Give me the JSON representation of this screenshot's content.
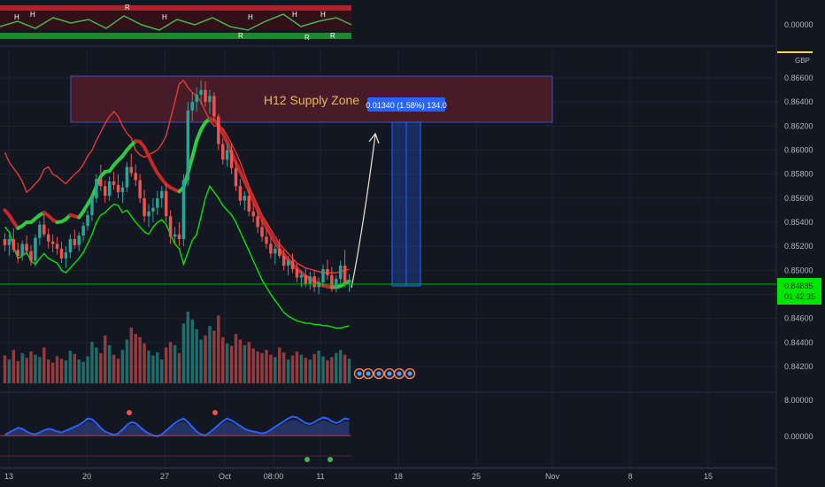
{
  "currency": "GBP",
  "price_axis": {
    "main_ticks": [
      "0.86600",
      "0.86400",
      "0.86200",
      "0.86000",
      "0.85800",
      "0.85600",
      "0.85400",
      "0.85200",
      "0.85000",
      "0.84800",
      "0.84600",
      "0.84400",
      "0.84200"
    ],
    "top_ticks": [
      "0.00000"
    ],
    "bottom_ticks": [
      "8.00000",
      "0.00000"
    ],
    "last_price": "0.84885",
    "countdown": "01:42:35"
  },
  "time_axis": {
    "labels": [
      "13",
      "20",
      "27",
      "Oct",
      "08:00",
      "11",
      "18",
      "25",
      "Nov",
      "8",
      "15"
    ]
  },
  "annotations": {
    "supply_zone_label": "H12 Supply Zone",
    "measure_label": "0.01340 (1.58%) 134.0"
  },
  "colors": {
    "background": "#131722",
    "up": "#26a69a",
    "down": "#ef5350",
    "supply_zone": "#5a1e2a",
    "measure": "#2962ff",
    "last_price": "#00e600"
  },
  "chart_data": {
    "type": "candlestick",
    "title": "",
    "ylim": [
      0.8408,
      0.8668
    ],
    "x_ticks": [
      "13",
      "20",
      "27",
      "Oct",
      "08:00",
      "11",
      "18",
      "25",
      "Nov",
      "8",
      "15"
    ],
    "candles": [
      [
        0.8526,
        0.8531,
        0.8516,
        0.8521
      ],
      [
        0.8521,
        0.853,
        0.8512,
        0.8526
      ],
      [
        0.8526,
        0.8535,
        0.8515,
        0.8517
      ],
      [
        0.8517,
        0.8523,
        0.8506,
        0.8512
      ],
      [
        0.8512,
        0.8525,
        0.8508,
        0.8522
      ],
      [
        0.8522,
        0.8529,
        0.8513,
        0.8516
      ],
      [
        0.8516,
        0.8521,
        0.8504,
        0.8508
      ],
      [
        0.8508,
        0.853,
        0.8503,
        0.8527
      ],
      [
        0.8527,
        0.8541,
        0.8521,
        0.8538
      ],
      [
        0.8538,
        0.8547,
        0.8528,
        0.853
      ],
      [
        0.853,
        0.8535,
        0.8518,
        0.8524
      ],
      [
        0.8524,
        0.853,
        0.8515,
        0.8522
      ],
      [
        0.8522,
        0.8528,
        0.8513,
        0.8518
      ],
      [
        0.8518,
        0.8524,
        0.8506,
        0.851
      ],
      [
        0.851,
        0.852,
        0.8502,
        0.8515
      ],
      [
        0.8515,
        0.853,
        0.851,
        0.8526
      ],
      [
        0.8526,
        0.8534,
        0.8518,
        0.8521
      ],
      [
        0.8521,
        0.8532,
        0.8516,
        0.8529
      ],
      [
        0.8529,
        0.854,
        0.8524,
        0.8537
      ],
      [
        0.8537,
        0.855,
        0.8533,
        0.8546
      ],
      [
        0.8546,
        0.8565,
        0.8541,
        0.856
      ],
      [
        0.856,
        0.858,
        0.8556,
        0.8576
      ],
      [
        0.8576,
        0.8588,
        0.8566,
        0.857
      ],
      [
        0.857,
        0.8575,
        0.8556,
        0.8562
      ],
      [
        0.8562,
        0.8578,
        0.8558,
        0.8574
      ],
      [
        0.8574,
        0.8582,
        0.8567,
        0.8571
      ],
      [
        0.8571,
        0.858,
        0.856,
        0.8565
      ],
      [
        0.8565,
        0.8574,
        0.8556,
        0.8569
      ],
      [
        0.8569,
        0.859,
        0.8565,
        0.8586
      ],
      [
        0.8586,
        0.8597,
        0.8578,
        0.8581
      ],
      [
        0.8581,
        0.8588,
        0.857,
        0.8575
      ],
      [
        0.8575,
        0.858,
        0.8556,
        0.856
      ],
      [
        0.856,
        0.8567,
        0.854,
        0.8545
      ],
      [
        0.8545,
        0.8555,
        0.8536,
        0.8549
      ],
      [
        0.8549,
        0.856,
        0.854,
        0.8552
      ],
      [
        0.8552,
        0.8566,
        0.8546,
        0.856
      ],
      [
        0.856,
        0.857,
        0.8552,
        0.8566
      ],
      [
        0.8566,
        0.8572,
        0.854,
        0.8545
      ],
      [
        0.8545,
        0.855,
        0.8522,
        0.8528
      ],
      [
        0.8528,
        0.8536,
        0.8522,
        0.853
      ],
      [
        0.853,
        0.854,
        0.852,
        0.8526
      ],
      [
        0.8526,
        0.858,
        0.852,
        0.8575
      ],
      [
        0.8575,
        0.864,
        0.857,
        0.8633
      ],
      [
        0.8633,
        0.8648,
        0.8624,
        0.864
      ],
      [
        0.864,
        0.8652,
        0.8632,
        0.8646
      ],
      [
        0.8646,
        0.8658,
        0.8638,
        0.865
      ],
      [
        0.865,
        0.8657,
        0.8636,
        0.864
      ],
      [
        0.864,
        0.865,
        0.863,
        0.8645
      ],
      [
        0.8645,
        0.8648,
        0.8624,
        0.8628
      ],
      [
        0.8628,
        0.863,
        0.86,
        0.8605
      ],
      [
        0.8605,
        0.861,
        0.8588,
        0.8592
      ],
      [
        0.8592,
        0.8605,
        0.8586,
        0.86
      ],
      [
        0.86,
        0.8606,
        0.858,
        0.8585
      ],
      [
        0.8585,
        0.859,
        0.8566,
        0.857
      ],
      [
        0.857,
        0.8576,
        0.8554,
        0.8558
      ],
      [
        0.8558,
        0.8566,
        0.855,
        0.8562
      ],
      [
        0.8562,
        0.8567,
        0.8545,
        0.8549
      ],
      [
        0.8549,
        0.8556,
        0.854,
        0.8545
      ],
      [
        0.8545,
        0.855,
        0.8531,
        0.8536
      ],
      [
        0.8536,
        0.8542,
        0.8524,
        0.8528
      ],
      [
        0.8528,
        0.8535,
        0.8518,
        0.8522
      ],
      [
        0.8522,
        0.8528,
        0.851,
        0.8514
      ],
      [
        0.8514,
        0.8521,
        0.8505,
        0.8518
      ],
      [
        0.8518,
        0.8526,
        0.851,
        0.8512
      ],
      [
        0.8512,
        0.8517,
        0.85,
        0.8504
      ],
      [
        0.8504,
        0.8512,
        0.8496,
        0.8508
      ],
      [
        0.8508,
        0.8514,
        0.8498,
        0.8501
      ],
      [
        0.8501,
        0.8506,
        0.849,
        0.8494
      ],
      [
        0.8494,
        0.85,
        0.8486,
        0.8496
      ],
      [
        0.8496,
        0.8502,
        0.8486,
        0.8489
      ],
      [
        0.8489,
        0.8499,
        0.8484,
        0.8495
      ],
      [
        0.8495,
        0.85,
        0.8482,
        0.8486
      ],
      [
        0.8486,
        0.8494,
        0.848,
        0.849
      ],
      [
        0.849,
        0.8505,
        0.8486,
        0.8501
      ],
      [
        0.8501,
        0.8509,
        0.8492,
        0.8496
      ],
      [
        0.8496,
        0.8503,
        0.8482,
        0.8485
      ],
      [
        0.8485,
        0.8496,
        0.8482,
        0.8493
      ],
      [
        0.8493,
        0.8508,
        0.8488,
        0.8504
      ],
      [
        0.8504,
        0.8517,
        0.8486,
        0.849
      ],
      [
        0.849,
        0.8497,
        0.8482,
        0.8492
      ]
    ],
    "volume": [
      0.35,
      0.3,
      0.42,
      0.28,
      0.38,
      0.32,
      0.4,
      0.36,
      0.33,
      0.45,
      0.3,
      0.26,
      0.34,
      0.31,
      0.29,
      0.41,
      0.37,
      0.3,
      0.27,
      0.34,
      0.52,
      0.45,
      0.38,
      0.6,
      0.48,
      0.36,
      0.31,
      0.42,
      0.55,
      0.7,
      0.62,
      0.58,
      0.5,
      0.41,
      0.35,
      0.39,
      0.3,
      0.45,
      0.52,
      0.48,
      0.38,
      0.75,
      0.9,
      0.8,
      0.68,
      0.55,
      0.6,
      0.72,
      0.66,
      0.85,
      0.58,
      0.5,
      0.47,
      0.62,
      0.55,
      0.48,
      0.52,
      0.44,
      0.4,
      0.38,
      0.42,
      0.36,
      0.33,
      0.45,
      0.39,
      0.3,
      0.35,
      0.4,
      0.36,
      0.32,
      0.3,
      0.37,
      0.41,
      0.34,
      0.29,
      0.33,
      0.38,
      0.42,
      0.36,
      0.31
    ],
    "upper_band": [
      0.858,
      0.857,
      0.8562,
      0.8555,
      0.856,
      0.8568,
      0.857,
      0.8574,
      0.8578,
      0.858,
      0.8576,
      0.857,
      0.8566,
      0.8568,
      0.8572,
      0.8578,
      0.8575,
      0.8572,
      0.8578,
      0.8584,
      0.859,
      0.86,
      0.8608,
      0.8612,
      0.861,
      0.8618,
      0.8625,
      0.863,
      0.8636,
      0.864,
      0.8645,
      0.8646,
      0.864,
      0.863,
      0.862,
      0.8612,
      0.8606,
      0.86,
      0.8598,
      0.8596,
      0.8595,
      0.8598,
      0.8602,
      0.8608,
      0.8616,
      0.8622,
      0.8626,
      0.8628,
      0.8628,
      0.8626,
      0.8622,
      0.8615,
      0.8606,
      0.8598,
      0.859,
      0.8582,
      0.8574,
      0.8566,
      0.8558,
      0.855,
      0.8544,
      0.8538,
      0.8532,
      0.8526,
      0.852,
      0.8516,
      0.8512,
      0.8508,
      0.8504,
      0.85,
      0.8498,
      0.8496,
      0.8494,
      0.8492,
      0.8491,
      0.849,
      0.849,
      0.8491,
      0.8493,
      0.8495
    ],
    "lower_band": [
      0.852,
      0.8522,
      0.8518,
      0.8515,
      0.8514,
      0.8512,
      0.851,
      0.8512,
      0.8514,
      0.8516,
      0.8515,
      0.8514,
      0.8514,
      0.8513,
      0.8513,
      0.8514,
      0.8515,
      0.8516,
      0.852,
      0.8526,
      0.8532,
      0.854,
      0.8548,
      0.8552,
      0.8555,
      0.8557,
      0.8558,
      0.856,
      0.8564,
      0.8568,
      0.857,
      0.8568,
      0.8565,
      0.856,
      0.8555,
      0.855,
      0.8546,
      0.8543,
      0.854,
      0.8538,
      0.8536,
      0.854,
      0.856,
      0.858,
      0.86,
      0.8612,
      0.862,
      0.8624,
      0.8622,
      0.8615,
      0.8606,
      0.8598,
      0.859,
      0.8582,
      0.8574,
      0.8566,
      0.8558,
      0.855,
      0.8542,
      0.8535,
      0.8528,
      0.8521,
      0.8515,
      0.851,
      0.8506,
      0.8502,
      0.8498,
      0.8495,
      0.8492,
      0.849,
      0.8488,
      0.8486,
      0.8484,
      0.8483,
      0.8482,
      0.8482,
      0.8482,
      0.8483,
      0.8485,
      0.8487
    ],
    "support_line": [
      0.8536,
      0.8532,
      0.852,
      0.851,
      0.8512,
      0.8515,
      0.8508,
      0.8505,
      0.851,
      0.8514,
      0.851,
      0.8508,
      0.8506,
      0.85,
      0.8498,
      0.8502,
      0.8506,
      0.851,
      0.8515,
      0.8522,
      0.853,
      0.854,
      0.8546,
      0.8548,
      0.8552,
      0.8555,
      0.8554,
      0.8548,
      0.855,
      0.8545,
      0.854,
      0.8536,
      0.8532,
      0.853,
      0.8536,
      0.854,
      0.8542,
      0.8538,
      0.853,
      0.8522,
      0.8518,
      0.8505,
      0.8515,
      0.8525,
      0.853,
      0.8545,
      0.856,
      0.857,
      0.8565,
      0.856,
      0.8554,
      0.855,
      0.8546,
      0.854,
      0.8532,
      0.8524,
      0.8516,
      0.8508,
      0.85,
      0.8492,
      0.8486,
      0.848,
      0.8475,
      0.847,
      0.8465,
      0.8462,
      0.846,
      0.8458,
      0.8457,
      0.8456,
      0.8456,
      0.8455,
      0.8455,
      0.8454,
      0.8454,
      0.8453,
      0.8452,
      0.8452,
      0.8453,
      0.8454
    ],
    "resistance_line": [
      0.8598,
      0.859,
      0.8585,
      0.858,
      0.8574,
      0.8565,
      0.8568,
      0.8572,
      0.8576,
      0.8584,
      0.8586,
      0.858,
      0.8578,
      0.8575,
      0.8572,
      0.8576,
      0.858,
      0.8583,
      0.8588,
      0.8595,
      0.86,
      0.8608,
      0.8615,
      0.8622,
      0.8628,
      0.8632,
      0.8628,
      0.862,
      0.8614,
      0.861,
      0.86,
      0.8596,
      0.8594,
      0.8596,
      0.8598,
      0.86,
      0.8605,
      0.8612,
      0.8626,
      0.864,
      0.8655,
      0.8658,
      0.8652,
      0.8648,
      0.8645,
      0.864,
      0.8632,
      0.8625,
      0.862,
      0.862,
      0.8618,
      0.8612,
      0.8605,
      0.8598,
      0.859,
      0.858,
      0.857,
      0.8562,
      0.8554,
      0.8546,
      0.854,
      0.8534,
      0.8528,
      0.8522,
      0.8518,
      0.8514,
      0.851,
      0.8506,
      0.8504,
      0.8502,
      0.8501,
      0.85,
      0.8499,
      0.8498,
      0.8498,
      0.8498,
      0.8498,
      0.8499,
      0.85,
      0.8501
    ],
    "supply_zone": [
      0.8625,
      0.8662
    ],
    "measure": {
      "from": 0.8492,
      "to": 0.8626,
      "change": "0.01340 (1.58%) 134.0"
    },
    "last_price": 0.84885,
    "oscillator": [
      0.45,
      0.5,
      0.55,
      0.6,
      0.58,
      0.52,
      0.48,
      0.46,
      0.5,
      0.55,
      0.58,
      0.56,
      0.52,
      0.5,
      0.54,
      0.58,
      0.62,
      0.66,
      0.72,
      0.8,
      0.78,
      0.7,
      0.6,
      0.52,
      0.48,
      0.45,
      0.48,
      0.56,
      0.66,
      0.72,
      0.7,
      0.62,
      0.54,
      0.48,
      0.44,
      0.42,
      0.46,
      0.54,
      0.62,
      0.7,
      0.76,
      0.8,
      0.72,
      0.62,
      0.52,
      0.46,
      0.44,
      0.5,
      0.58,
      0.66,
      0.74,
      0.8,
      0.76,
      0.7,
      0.64,
      0.58,
      0.54,
      0.52,
      0.5,
      0.48,
      0.5,
      0.56,
      0.62,
      0.68,
      0.74,
      0.8,
      0.84,
      0.82,
      0.76,
      0.7,
      0.68,
      0.72,
      0.78,
      0.82,
      0.8,
      0.74,
      0.7,
      0.74,
      0.8,
      0.78
    ]
  }
}
